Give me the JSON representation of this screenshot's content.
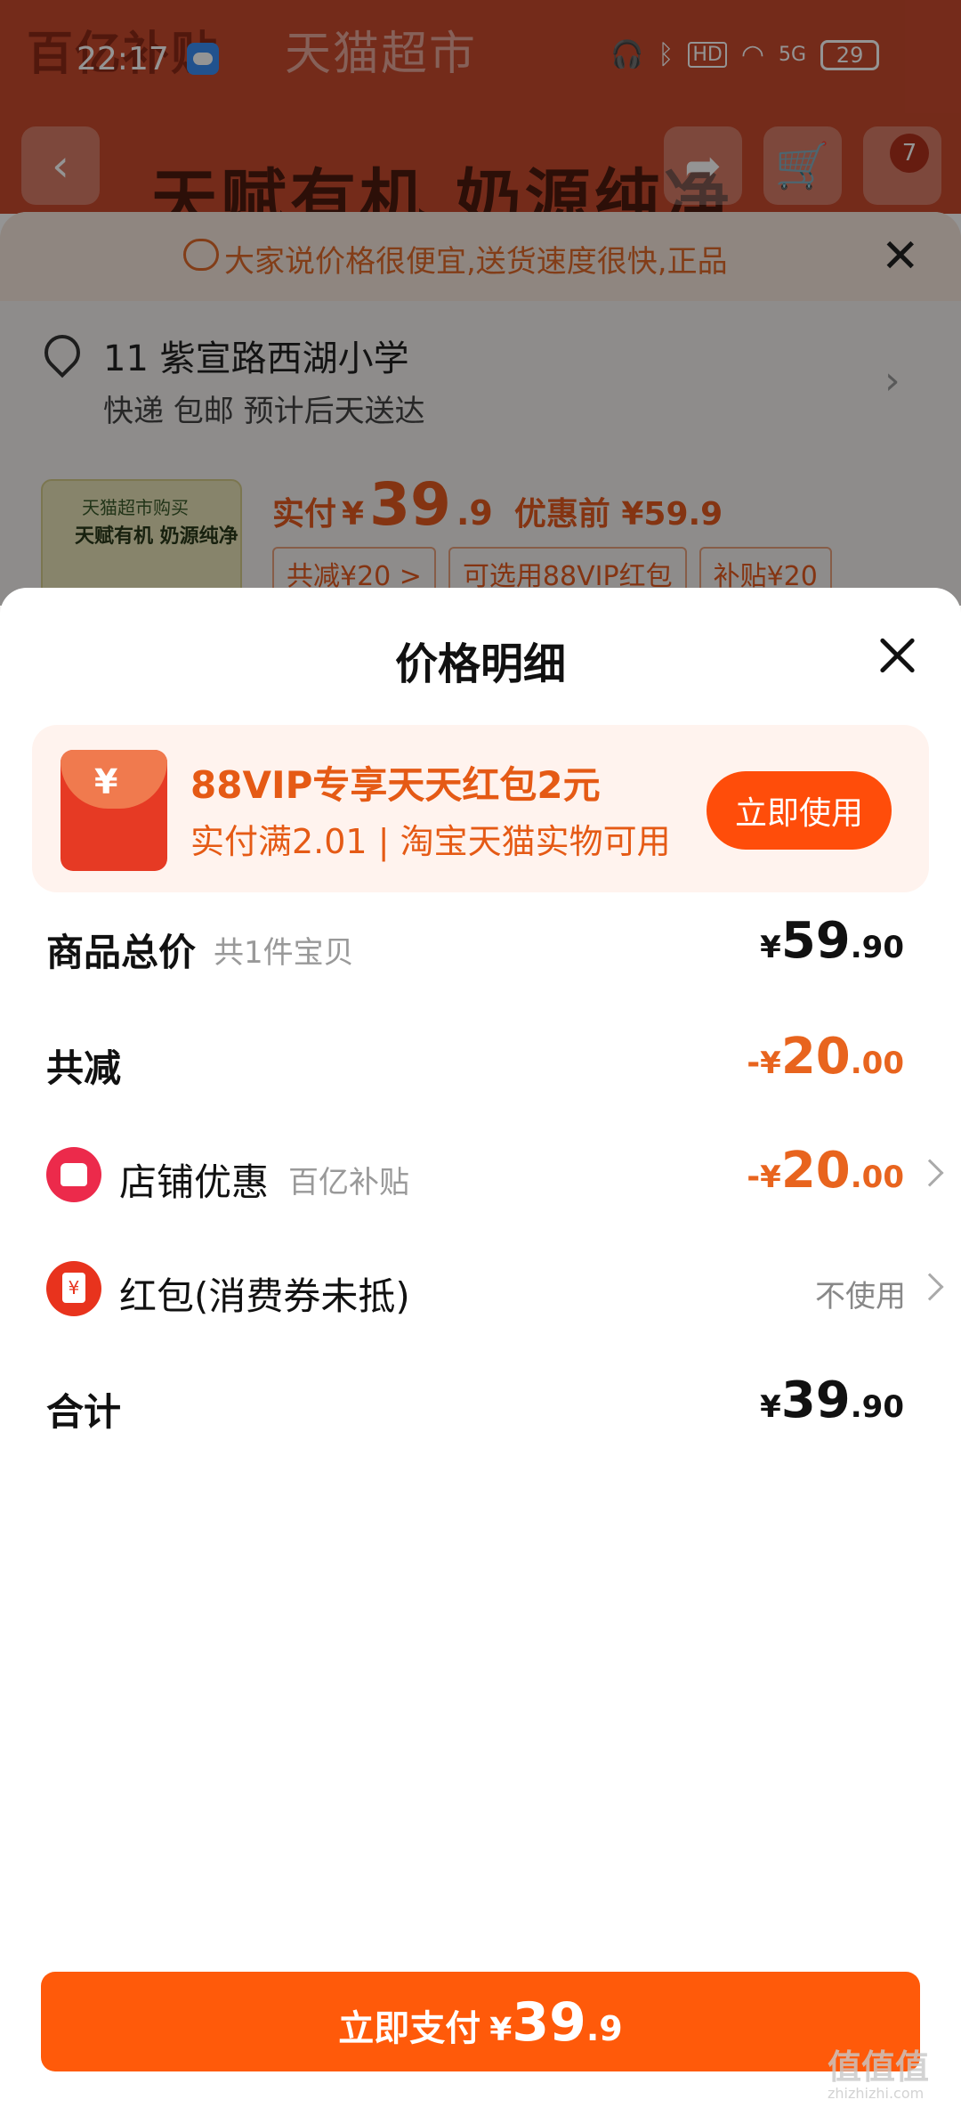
{
  "status_bar": {
    "time": "22:17",
    "icons": [
      "headphones-icon",
      "bluetooth-icon",
      "hd-icon",
      "wifi-icon",
      "5g-signal-icon"
    ],
    "hd": "HD",
    "signal": "5G",
    "battery": "29"
  },
  "background_page": {
    "banner": "百亿补贴",
    "banner_sub": "天猫超市",
    "slogan": "天赋有机 奶源纯净",
    "cart_count": "7"
  },
  "order_info": {
    "tip": "大家说价格很便宜,送货速度很快,正品",
    "address_line1": "11 紫宣路西湖小学",
    "address_line2": "快递 包邮 预计后天送达",
    "product_thumb_label": "天猫超市购买",
    "product_thumb_title": "天赋有机 奶源纯净",
    "price_label": "实付",
    "price_currency": "¥",
    "price_int": "39",
    "price_dec": ".9",
    "price_before": "优惠前 ¥59.9",
    "tags": [
      "共减¥20 >",
      "可选用88VIP红包",
      "补贴¥20"
    ]
  },
  "sheet": {
    "title": "价格明细",
    "promo": {
      "icon_char": "¥",
      "title": "88VIP专享天天红包2元",
      "subtitle": "实付满2.01 | 淘宝天猫实物可用",
      "button": "立即使用"
    },
    "rows": {
      "total": {
        "label": "商品总价",
        "sub": "共1件宝贝",
        "currency": "¥",
        "int": "59",
        "dec": ".90"
      },
      "reduced": {
        "label": "共减",
        "sign": "-",
        "currency": "¥",
        "int": "20",
        "dec": ".00"
      },
      "shop": {
        "label": "店铺优惠",
        "sub": "百亿补贴",
        "sign": "-",
        "currency": "¥",
        "int": "20",
        "dec": ".00"
      },
      "redpacket": {
        "label": "红包(消费券未抵)",
        "value": "不使用"
      },
      "sum": {
        "label": "合计",
        "currency": "¥",
        "int": "39",
        "dec": ".90"
      }
    },
    "pay_button": {
      "label": "立即支付",
      "currency": "¥",
      "int": "39",
      "dec": ".9"
    }
  },
  "watermark": {
    "main": "值值值",
    "sub": "zhizhizhi.com"
  },
  "colors": {
    "accent": "#ff5a0a",
    "orange_text": "#e8641e",
    "shop_icon": "#ec2a4b"
  }
}
